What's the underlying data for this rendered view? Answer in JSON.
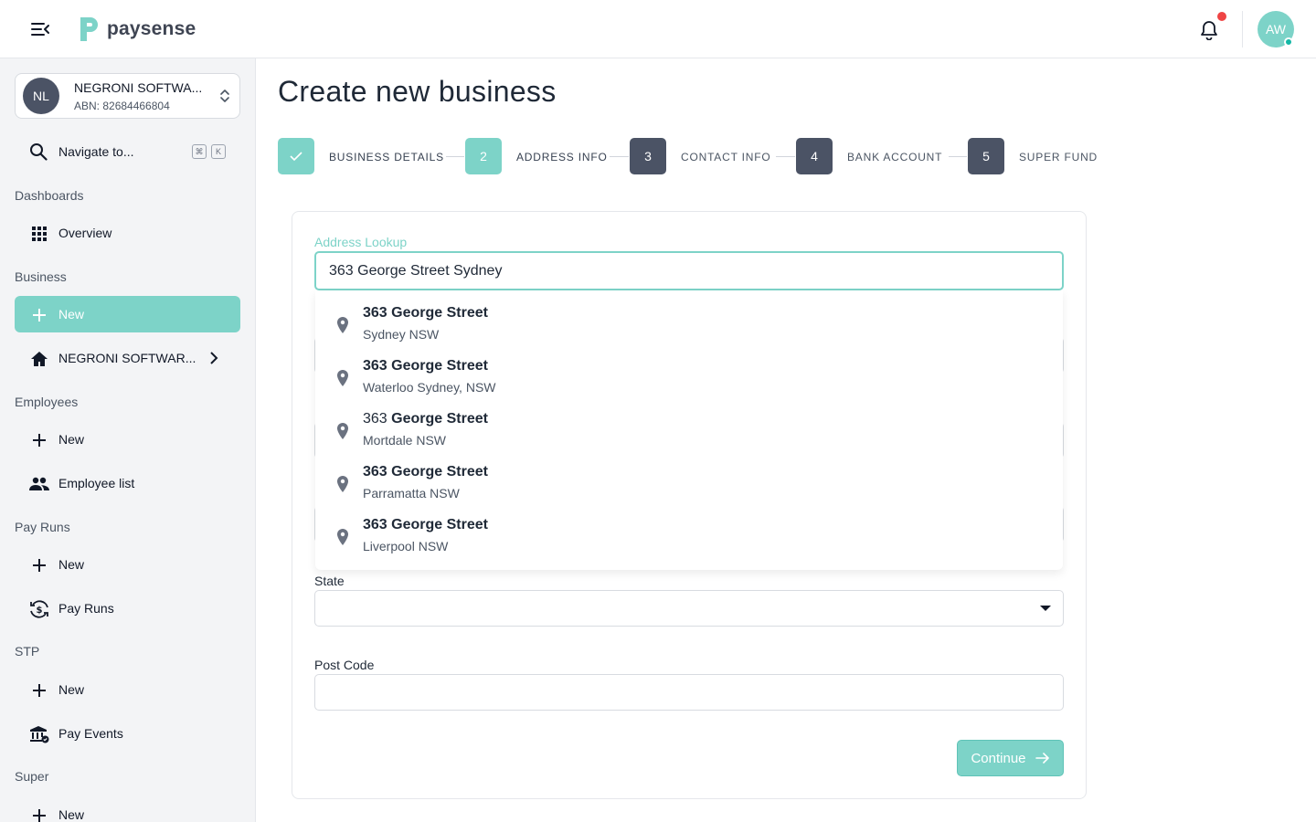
{
  "app": {
    "logo_text": "paysense",
    "accent_color": "#7dd3c8",
    "dark_color": "#4b5365"
  },
  "header": {
    "avatar_initials": "AW",
    "notification_indicator": true
  },
  "sidebar": {
    "org": {
      "initials": "NL",
      "name": "NEGRONI SOFTWA...",
      "abn": "ABN: 82684466804"
    },
    "search": {
      "label": "Navigate to...",
      "shortcut_keys": [
        "⌘",
        "K"
      ]
    },
    "sections": {
      "dashboards": "Dashboards",
      "business": "Business",
      "employees": "Employees",
      "pay_runs": "Pay Runs",
      "stp": "STP",
      "super": "Super"
    },
    "items": {
      "overview": "Overview",
      "business_new": "New",
      "business_org": "NEGRONI SOFTWAR...",
      "employees_new": "New",
      "employee_list": "Employee list",
      "payruns_new": "New",
      "pay_runs": "Pay Runs",
      "stp_new": "New",
      "pay_events": "Pay Events",
      "super_new": "New"
    }
  },
  "main": {
    "title": "Create new business",
    "steps": [
      {
        "number": "✓",
        "label": "BUSINESS DETAILS",
        "state": "done"
      },
      {
        "number": "2",
        "label": "ADDRESS INFO",
        "state": "current"
      },
      {
        "number": "3",
        "label": "CONTACT INFO",
        "state": "todo"
      },
      {
        "number": "4",
        "label": "BANK ACCOUNT",
        "state": "todo"
      },
      {
        "number": "5",
        "label": "SUPER FUND",
        "state": "todo"
      }
    ],
    "form": {
      "address_lookup_label": "Address Lookup",
      "address_lookup_value": "363 George Street Sydney",
      "suggestions": [
        {
          "number": "363",
          "street": "George Street",
          "number_bold": true,
          "locality": "Sydney NSW"
        },
        {
          "number": "363",
          "street": "George Street",
          "number_bold": true,
          "locality": "Waterloo Sydney, NSW"
        },
        {
          "number": "363",
          "street": "George Street",
          "number_bold": false,
          "locality": "Mortdale NSW"
        },
        {
          "number": "363",
          "street": "George Street",
          "number_bold": true,
          "locality": "Parramatta NSW"
        },
        {
          "number": "363",
          "street": "George Street",
          "number_bold": true,
          "locality": "Liverpool NSW"
        }
      ],
      "state_label": "State",
      "state_value": "",
      "postcode_label": "Post Code",
      "postcode_value": "",
      "continue_label": "Continue"
    }
  }
}
